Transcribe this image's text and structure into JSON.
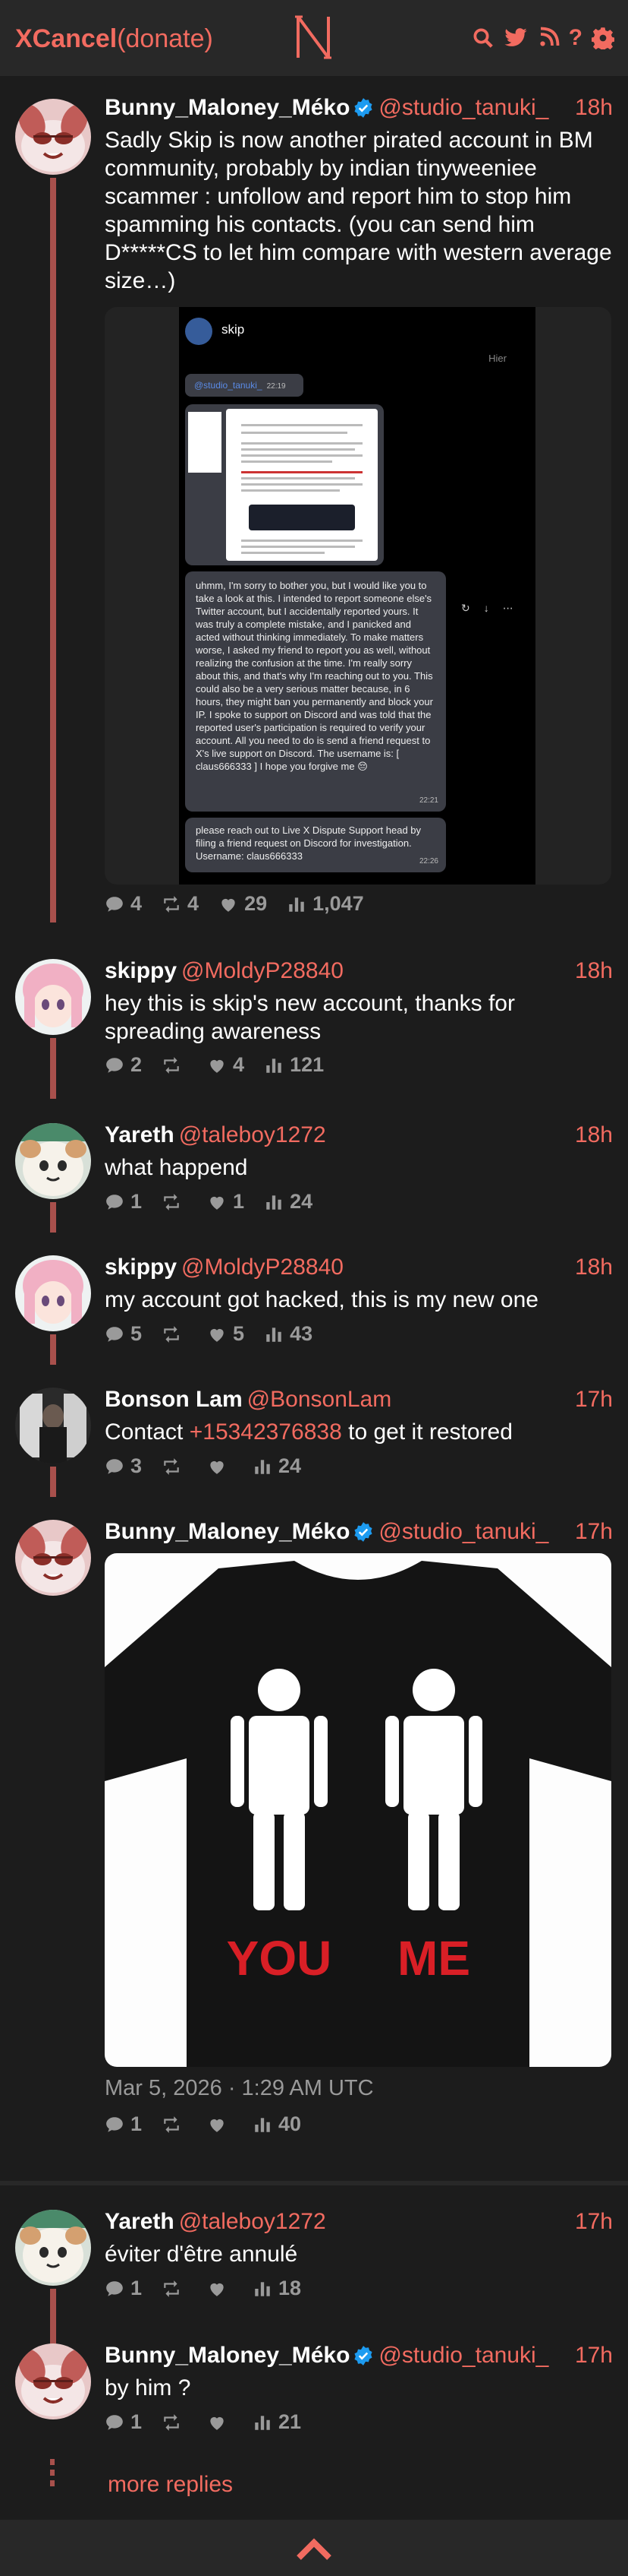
{
  "header": {
    "brand": "XCancel",
    "donate": "(donate)",
    "logo_letter": "N",
    "icons": [
      "search-icon",
      "twitter-bird-icon",
      "rss-icon",
      "help-icon",
      "gear-icon"
    ],
    "help_text": "?"
  },
  "colors": {
    "accent": "#f26b60",
    "thread": "#a8504c",
    "background": "#1c1c1c",
    "verified": "#1d9bf0"
  },
  "tweets": [
    {
      "name": "Bunny_Maloney_Méko",
      "handle": "@studio_tanuki_",
      "time": "18h",
      "text": "Sadly Skip is now another pirated account in BM community, probably by indian tinyweeniee scammer : unfollow and report him to stop him spamming his contacts. (you can send him D*****CS  to let him compare with western average size…)",
      "stats": {
        "replies": "4",
        "retweets": "4",
        "likes": "29",
        "views": "1,047"
      },
      "media": {
        "contact_name": "skip",
        "day_label": "Hier",
        "mention": "@studio_tanuki_",
        "mention_time": "22:19",
        "message_1": "uhmm, I'm sorry to bother you, but I would like you to take a look at this. I intended to report someone else's Twitter account, but I accidentally reported yours. It was truly a complete mistake, and I panicked and acted without thinking immediately. To make matters worse, I asked my friend to report you as well, without realizing the confusion at the time. I'm really sorry about this, and that's why I'm reaching out to you. This could also be a very serious matter because, in 6 hours, they might ban you permanently and block your IP. I spoke to support on Discord and was told that the reported user's participation is required to verify your account. All you need to do is send a friend request to X's live support on Discord. The username is: [ claus666333 ] I hope you forgive me 😔",
        "message_1_time": "22:21",
        "message_2": "please reach out to Live X Dispute Support head by filing a friend request on Discord for investigation. Username: claus666333",
        "message_2_time": "22:26"
      }
    },
    {
      "name": "skippy",
      "handle": "@MoldyP28840",
      "time": "18h",
      "text": "hey this is skip's new account, thanks for spreading awareness",
      "stats": {
        "replies": "2",
        "retweets": "",
        "likes": "4",
        "views": "121"
      }
    },
    {
      "name": "Yareth",
      "handle": "@taleboy1272",
      "time": "18h",
      "text": "what happend",
      "stats": {
        "replies": "1",
        "retweets": "",
        "likes": "1",
        "views": "24"
      }
    },
    {
      "name": "skippy",
      "handle": "@MoldyP28840",
      "time": "18h",
      "text": "my account got hacked, this is my new one",
      "stats": {
        "replies": "5",
        "retweets": "",
        "likes": "5",
        "views": "43"
      }
    },
    {
      "name": "Bonson Lam",
      "handle": "@BonsonLam",
      "time": "17h",
      "text_before": "Contact ",
      "phone": "+15342376838",
      "text_after": " to get it restored",
      "stats": {
        "replies": "3",
        "retweets": "",
        "likes": "",
        "views": "24"
      }
    },
    {
      "name": "Bunny_Maloney_Méko",
      "handle": "@studio_tanuki_",
      "time": "17h",
      "image_text_left": "YOU",
      "image_text_right": "ME",
      "date": "Mar 5, 2026 · 1:29 AM UTC",
      "stats": {
        "replies": "1",
        "retweets": "",
        "likes": "",
        "views": "40"
      }
    },
    {
      "name": "Yareth",
      "handle": "@taleboy1272",
      "time": "17h",
      "text": "éviter d'être annulé",
      "stats": {
        "replies": "1",
        "retweets": "",
        "likes": "",
        "views": "18"
      }
    },
    {
      "name": "Bunny_Maloney_Méko",
      "handle": "@studio_tanuki_",
      "time": "17h",
      "text": "by him ?",
      "stats": {
        "replies": "1",
        "retweets": "",
        "likes": "",
        "views": "21"
      }
    }
  ],
  "more_replies": "more replies"
}
